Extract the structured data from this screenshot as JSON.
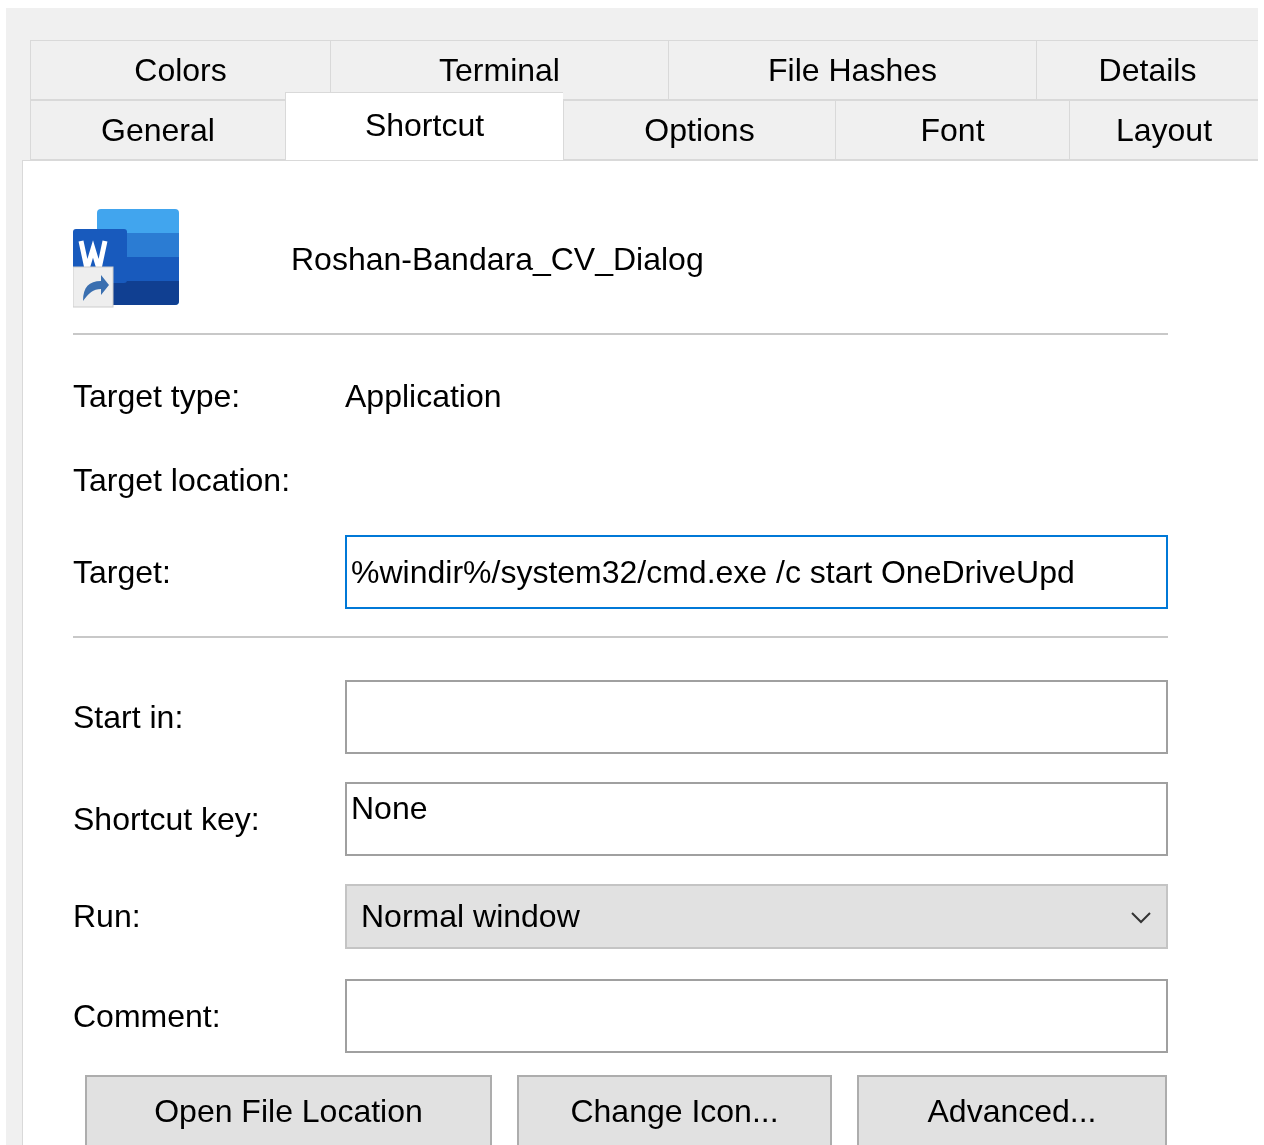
{
  "tab_rows": [
    {
      "tabs": [
        {
          "label": "Colors",
          "selected": false
        },
        {
          "label": "Terminal",
          "selected": false
        },
        {
          "label": "File Hashes",
          "selected": false
        },
        {
          "label": "Details",
          "selected": false
        }
      ]
    },
    {
      "tabs": [
        {
          "label": "General",
          "selected": false
        },
        {
          "label": "Shortcut",
          "selected": true
        },
        {
          "label": "Options",
          "selected": false
        },
        {
          "label": "Font",
          "selected": false
        },
        {
          "label": "Layout",
          "selected": false
        }
      ]
    }
  ],
  "shortcut_name": "Roshan-Bandara_CV_Dialog",
  "info": [
    {
      "label": "Target type:",
      "value": "Application"
    },
    {
      "label": "Target location:"
    }
  ],
  "target": {
    "label": "Target:",
    "value": "%windir%/system32/cmd.exe /c start OneDriveUpd",
    "focused": true
  },
  "fields": [
    {
      "kind": "text",
      "label": "Start in:"
    },
    {
      "kind": "text",
      "label": "Shortcut key:",
      "value": "None"
    },
    {
      "kind": "dropdown",
      "label": "Run:",
      "value": "Normal window"
    },
    {
      "kind": "text",
      "label": "Comment:"
    }
  ],
  "buttons": [
    "Open File Location",
    "Change Icon...",
    "Advanced..."
  ]
}
